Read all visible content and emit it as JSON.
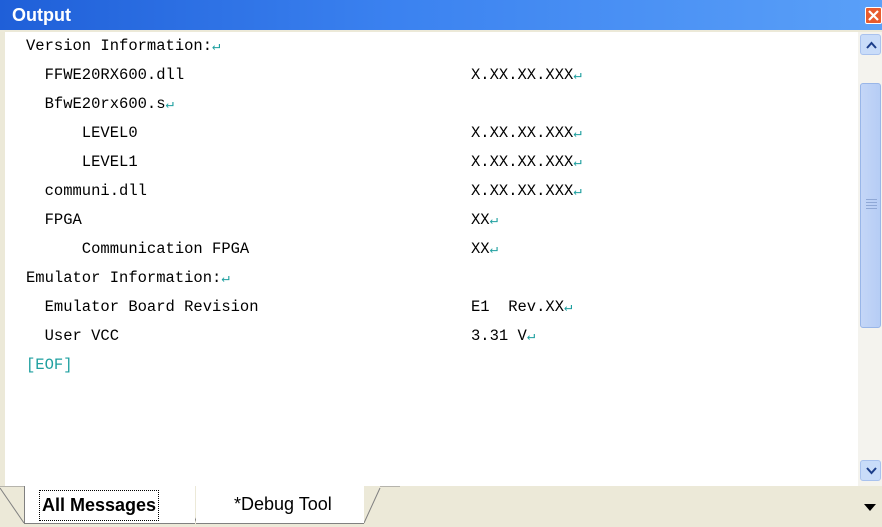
{
  "window": {
    "title": "Output"
  },
  "output": {
    "lines": [
      {
        "label": "Version Information:",
        "value": "",
        "eol": true
      },
      {
        "label": "  FFWE20RX600.dll",
        "value": "X.XX.XX.XXX",
        "eol": true
      },
      {
        "label": "  BfwE20rx600.s",
        "value": "",
        "eol": true
      },
      {
        "label": "      LEVEL0",
        "value": "X.XX.XX.XXX",
        "eol": true
      },
      {
        "label": "      LEVEL1",
        "value": "X.XX.XX.XXX",
        "eol": true
      },
      {
        "label": "  communi.dll",
        "value": "X.XX.XX.XXX",
        "eol": true
      },
      {
        "label": "  FPGA",
        "value": "XX",
        "eol": true
      },
      {
        "label": "      Communication FPGA",
        "value": "XX",
        "eol": true
      },
      {
        "label": "Emulator Information:",
        "value": "",
        "eol": true
      },
      {
        "label": "  Emulator Board Revision",
        "value": "E1  Rev.XX",
        "eol": true
      },
      {
        "label": "  User VCC",
        "value": "3.31 V",
        "eol": true
      },
      {
        "label": "[EOF]",
        "value": "",
        "eol": false
      }
    ]
  },
  "tabs": [
    {
      "label": "All Messages",
      "active": true
    },
    {
      "label": "*Debug Tool",
      "active": false
    }
  ],
  "icons": {
    "close": "close-icon",
    "scroll_up": "arrow-up-icon",
    "scroll_down": "arrow-down-icon",
    "tab_menu": "chevron-down-icon"
  },
  "colors": {
    "title_bar": "#3b82f0",
    "eol_marker": "#1fa0a0"
  }
}
